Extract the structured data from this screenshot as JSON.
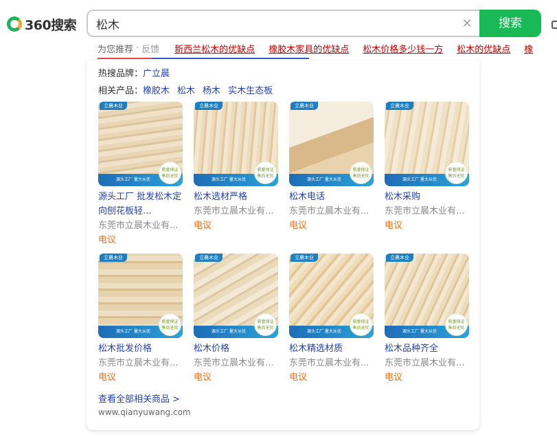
{
  "header": {
    "logo_text": "360搜索",
    "search_value": "松木",
    "search_button": "搜索",
    "clear_label": "×"
  },
  "suggest": {
    "label": "为您推荐",
    "separator": "·",
    "feedback": "反馈",
    "links": [
      "新西兰松木的优缺点",
      "橡胶木家具的优缺点",
      "松木价格多少钱一方",
      "松木的优缺点",
      "橡"
    ]
  },
  "brands": {
    "label": "热搜品牌：",
    "items": [
      "广立晨"
    ]
  },
  "related": {
    "label": "相关产品：",
    "items": [
      "橡胶木",
      "松木",
      "杨木",
      "实木生态板"
    ]
  },
  "products": [
    {
      "title": "源头工厂 批发松木定向刨花板轻...",
      "shop": "东莞市立晨木业有...",
      "price": "电议",
      "badge": "立晨木业",
      "banner": "源头工厂 量大从优",
      "seal": "质量保证 售后无忧"
    },
    {
      "title": "松木选材严格",
      "shop": "东莞市立晨木业有...",
      "price": "电议",
      "badge": "立晨木业",
      "banner": "源头工厂 量大从优",
      "seal": "质量保证 售后无忧"
    },
    {
      "title": "松木电话",
      "shop": "东莞市立晨木业有...",
      "price": "电议",
      "badge": "立晨木业",
      "banner": "源头工厂 量大从优",
      "seal": "质量保证 售后无忧"
    },
    {
      "title": "松木采购",
      "shop": "东莞市立晨木业有...",
      "price": "电议",
      "badge": "立晨木业",
      "banner": "源头工厂 量大从优",
      "seal": "质量保证 售后无忧"
    },
    {
      "title": "松木批发价格",
      "shop": "东莞市立晨木业有...",
      "price": "电议",
      "badge": "立晨木业",
      "banner": "源头工厂 量大从优",
      "seal": "质量保证 售后无忧"
    },
    {
      "title": "松木价格",
      "shop": "东莞市立晨木业有...",
      "price": "电议",
      "badge": "立晨木业",
      "banner": "源头工厂 量大从优",
      "seal": "质量保证 售后无忧"
    },
    {
      "title": "松木精选材质",
      "shop": "东莞市立晨木业有...",
      "price": "电议",
      "badge": "立晨木业",
      "banner": "源头工厂 量大从优",
      "seal": "质量保证 售后无忧"
    },
    {
      "title": "松木品种齐全",
      "shop": "东莞市立晨木业有...",
      "price": "电议",
      "badge": "立晨木业",
      "banner": "源头工厂 量大从优",
      "seal": "质量保证 售后无忧"
    }
  ],
  "see_all": "查看全部相关商品 >",
  "source": "www.qianyuwang.com",
  "colors": {
    "accent": "#19b955",
    "link": "#2440b3",
    "price": "#f46b09",
    "suggest": "#cc0000"
  }
}
